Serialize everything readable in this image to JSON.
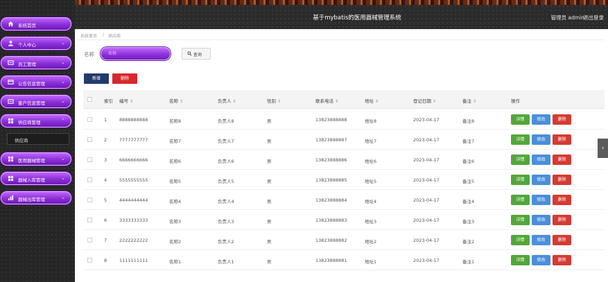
{
  "header": {
    "title": "基于mybatis的医用器械管理系统",
    "user": "管理员 admin",
    "logout": "退出登录"
  },
  "sidebar": {
    "items": [
      {
        "label": "系统首页",
        "icon": "home-icon"
      },
      {
        "label": "个人中心",
        "icon": "user-icon"
      },
      {
        "label": "员工管理",
        "icon": "staff-icon"
      },
      {
        "label": "公告信息管理",
        "icon": "notice-icon"
      },
      {
        "label": "客户信息管理",
        "icon": "customer-icon"
      },
      {
        "label": "供应商管理",
        "icon": "grid-icon"
      },
      {
        "label": "医用器械管理",
        "icon": "grid-icon"
      },
      {
        "label": "器械入库管理",
        "icon": "grid-icon"
      },
      {
        "label": "器械出库管理",
        "icon": "chart-icon"
      }
    ],
    "sub_item": "供应商"
  },
  "breadcrumb": {
    "home": "系统首页",
    "sep": "/",
    "current": "供应商"
  },
  "search": {
    "label": "名称",
    "placeholder": "名称",
    "button": "查询"
  },
  "toolbar": {
    "add": "新增",
    "delete": "删除"
  },
  "table": {
    "headers": [
      "索引",
      "编号",
      "名称",
      "负责人",
      "性别",
      "联系电话",
      "地址",
      "登记日期",
      "备注",
      "操作"
    ],
    "rows": [
      {
        "index": "1",
        "code": "8888888888",
        "name": "名称8",
        "manager": "负责人8",
        "gender": "男",
        "phone": "13823888888",
        "address": "地址8",
        "date": "2023-04-17",
        "note": "备注8"
      },
      {
        "index": "2",
        "code": "7777777777",
        "name": "名称7",
        "manager": "负责人7",
        "gender": "男",
        "phone": "13823888887",
        "address": "地址7",
        "date": "2023-04-17",
        "note": "备注7"
      },
      {
        "index": "3",
        "code": "6666666666",
        "name": "名称6",
        "manager": "负责人6",
        "gender": "男",
        "phone": "13823888886",
        "address": "地址6",
        "date": "2023-04-17",
        "note": "备注6"
      },
      {
        "index": "4",
        "code": "5555555555",
        "name": "名称5",
        "manager": "负责人5",
        "gender": "男",
        "phone": "13823888885",
        "address": "地址5",
        "date": "2023-04-17",
        "note": "备注5"
      },
      {
        "index": "5",
        "code": "4444444444",
        "name": "名称4",
        "manager": "负责人4",
        "gender": "男",
        "phone": "13823888884",
        "address": "地址4",
        "date": "2023-04-17",
        "note": "备注4"
      },
      {
        "index": "6",
        "code": "3333333333",
        "name": "名称3",
        "manager": "负责人3",
        "gender": "男",
        "phone": "13823888883",
        "address": "地址3",
        "date": "2023-04-17",
        "note": "备注3"
      },
      {
        "index": "7",
        "code": "2222222222",
        "name": "名称2",
        "manager": "负责人2",
        "gender": "男",
        "phone": "13823888882",
        "address": "地址2",
        "date": "2023-04-17",
        "note": "备注2"
      },
      {
        "index": "8",
        "code": "1111111111",
        "name": "名称1",
        "manager": "负责人1",
        "gender": "男",
        "phone": "13823888881",
        "address": "地址1",
        "date": "2023-04-17",
        "note": "备注1"
      }
    ],
    "actions": {
      "detail": "详情",
      "edit": "修改",
      "delete": "删除"
    }
  },
  "colors": {
    "purple": "#8b2fd6",
    "navy": "#1f3c6b",
    "red": "#d8282c",
    "green": "#54a63b",
    "blue": "#4a8fd9"
  },
  "side_tab_icon": "chevron-left-icon"
}
